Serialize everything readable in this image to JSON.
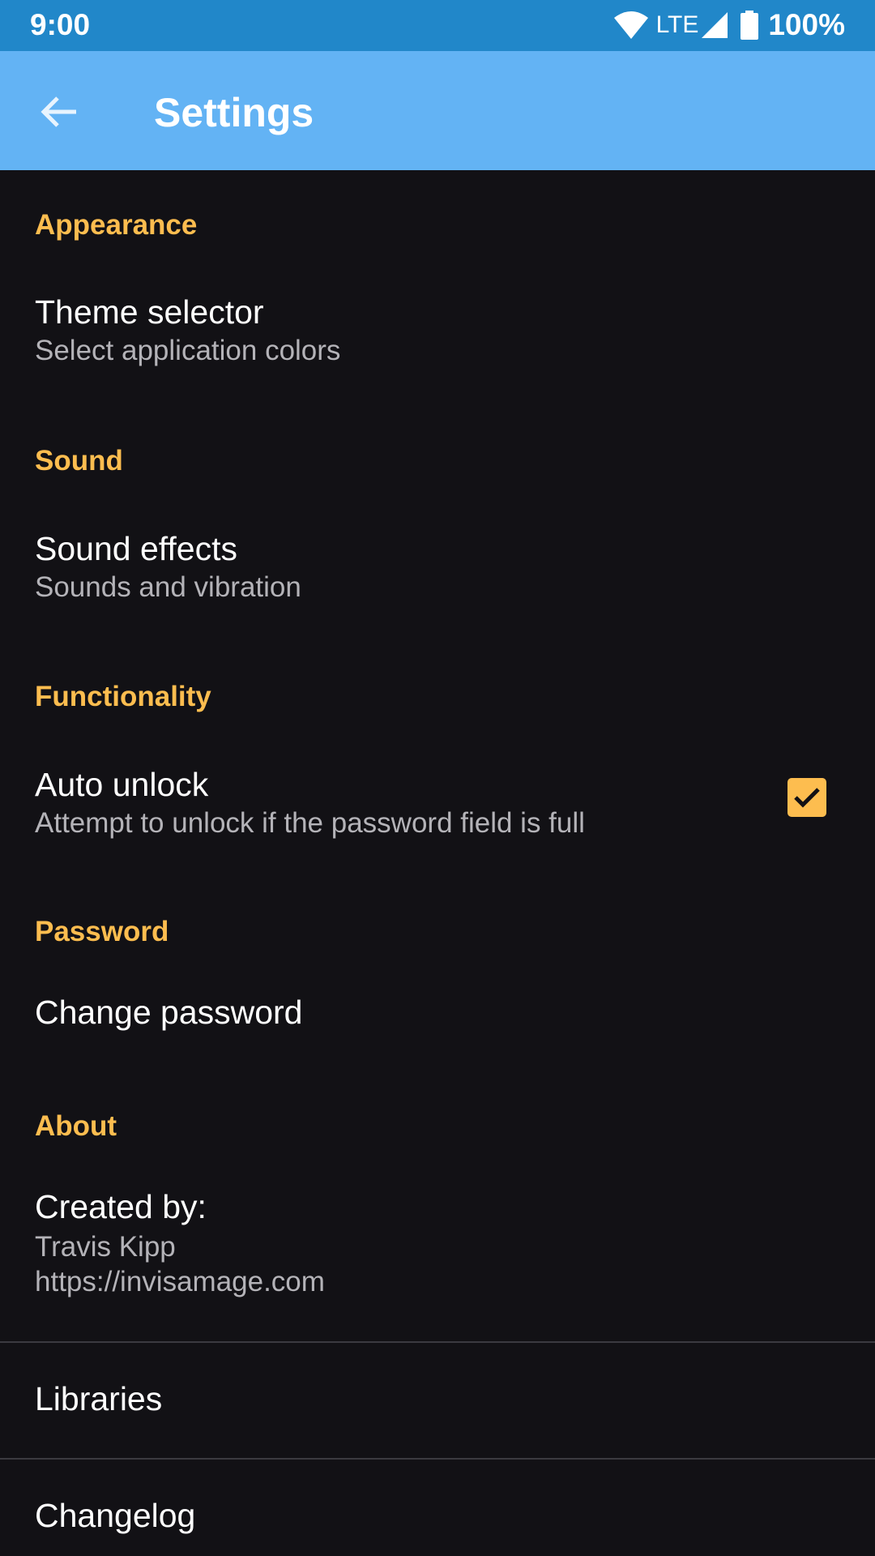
{
  "status_bar": {
    "time": "9:00",
    "network": "LTE",
    "battery": "100%"
  },
  "app_bar": {
    "title": "Settings"
  },
  "accent_color": "#fdbd4f",
  "sections": {
    "appearance": {
      "header": "Appearance",
      "theme": {
        "title": "Theme selector",
        "summary": "Select application colors"
      }
    },
    "sound": {
      "header": "Sound",
      "effects": {
        "title": "Sound effects",
        "summary": "Sounds and vibration"
      }
    },
    "functionality": {
      "header": "Functionality",
      "auto_unlock": {
        "title": "Auto unlock",
        "summary": "Attempt to unlock if the password field is full",
        "checked": true
      }
    },
    "password": {
      "header": "Password",
      "change": {
        "title": "Change password"
      }
    },
    "about": {
      "header": "About",
      "created_by": {
        "title": "Created by:",
        "author": "Travis Kipp",
        "url": "https://invisamage.com"
      },
      "libraries": {
        "title": "Libraries"
      },
      "changelog": {
        "title": "Changelog"
      }
    }
  }
}
